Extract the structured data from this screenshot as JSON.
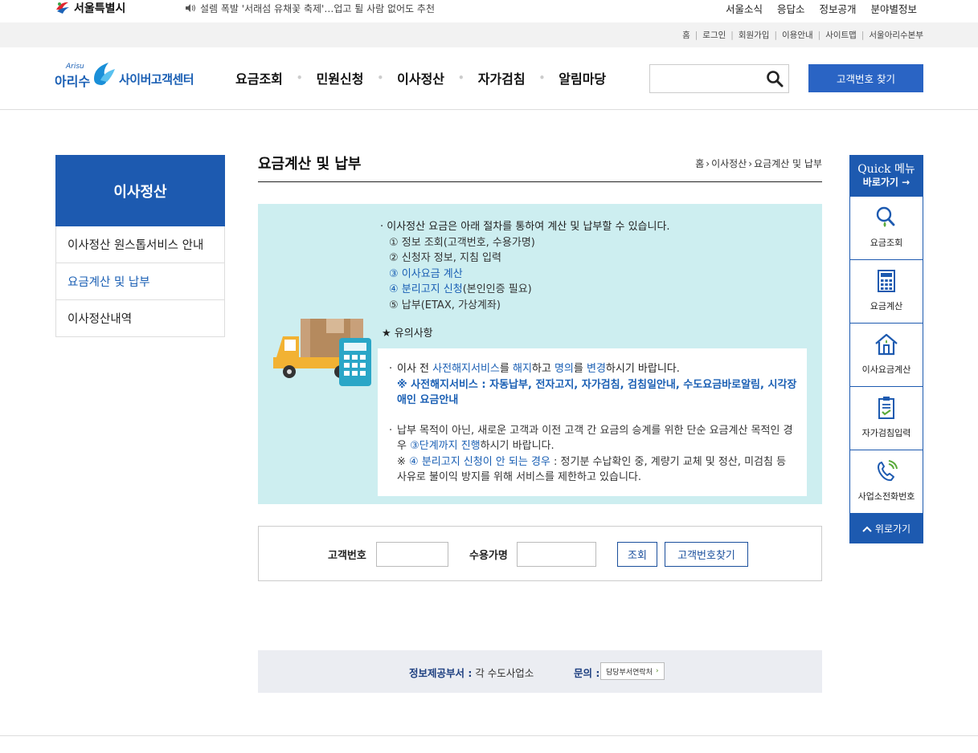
{
  "seoul_bar": {
    "logo_text": "서울특별시",
    "news": "설렘 폭발 '서래섬 유채꽃 축제'…업고 튈 사람 없어도 추천",
    "links": [
      "서울소식",
      "응답소",
      "정보공개",
      "분야별정보"
    ]
  },
  "util_links": [
    "홈",
    "로그인",
    "회원가입",
    "이용안내",
    "사이트맵",
    "서울아리수본부"
  ],
  "brand": {
    "small": "Arisu",
    "name": "아리수",
    "sub": "사이버고객센터"
  },
  "gnb": [
    "요금조회",
    "민원신청",
    "이사정산",
    "자가검침",
    "알림마당"
  ],
  "search": {
    "placeholder": "",
    "button_label": "고객번호 찾기"
  },
  "lnb": {
    "title": "이사정산",
    "items": [
      "이사정산 원스톱서비스 안내",
      "요금계산 및 납부",
      "이사정산내역"
    ]
  },
  "page": {
    "title": "요금계산 및 납부",
    "breadcrumb": [
      "홈",
      "이사정산",
      "요금계산 및 납부"
    ]
  },
  "info": {
    "lead": "· 이사정산 요금은 아래 절차를 통하여 계산 및 납부할 수 있습니다.",
    "step1": "① 정보 조회(고객번호, 수용가명)",
    "step2": "② 신청자 정보, 지침 입력",
    "step3": "③ 이사요금 계산",
    "step4_a": "④ 분리고지 신청",
    "step4_b": "(본인인증 필요)",
    "step5": "⑤ 납부(ETAX, 가상계좌)",
    "notice_head": "★ 유의사항",
    "n1_a": "이사 전 ",
    "n1_b": "사전해지서비스",
    "n1_c": "를 ",
    "n1_d": "해지",
    "n1_e": "하고 ",
    "n1_f": "명의",
    "n1_g": "를 ",
    "n1_h": "변경",
    "n1_i": "하시기 바랍니다.",
    "n1_note": "※ 사전해지서비스 : 자동납부, 전자고지, 자가검침, 검침일안내, 수도요금바로알림, 시각장애인 요금안내",
    "n2_a": "납부 목적이 아닌, 새로운 고객과 이전 고객 간 요금의 승계를 위한 단순 요금계산 목적인 경우 ",
    "n2_b": "③단계까지 진행",
    "n2_c": "하시기 바랍니다.",
    "n3_a": "※ ",
    "n3_b": "④ 분리고지 신청이 안 되는 경우",
    "n3_c": " : 정기분 수납확인 중, 계량기 교체 및 정산, 미검침 등 사유로 불이익 방지를 위해 서비스를 제한하고 있습니다."
  },
  "form": {
    "customer_no_label": "고객번호",
    "customer_no_value": "",
    "name_label": "수용가명",
    "name_value": "",
    "search_btn": "조회",
    "find_btn": "고객번호찾기"
  },
  "dept": {
    "label": "정보제공부서 :",
    "value": " 각 수도사업소",
    "inquiry_label": "문의 :",
    "contact_btn": "담당부서연락처"
  },
  "quick": {
    "head1": "Quick 메뉴",
    "head2": "바로가기 →",
    "items": [
      "요금조회",
      "요금계산",
      "이사요금계산",
      "자가검침입력",
      "사업소전화번호"
    ],
    "top": "위로가기"
  },
  "colors": {
    "primary_blue": "#1d5ab0",
    "panel_bg": "#cdeef0",
    "link_blue": "#1a5fb4"
  }
}
